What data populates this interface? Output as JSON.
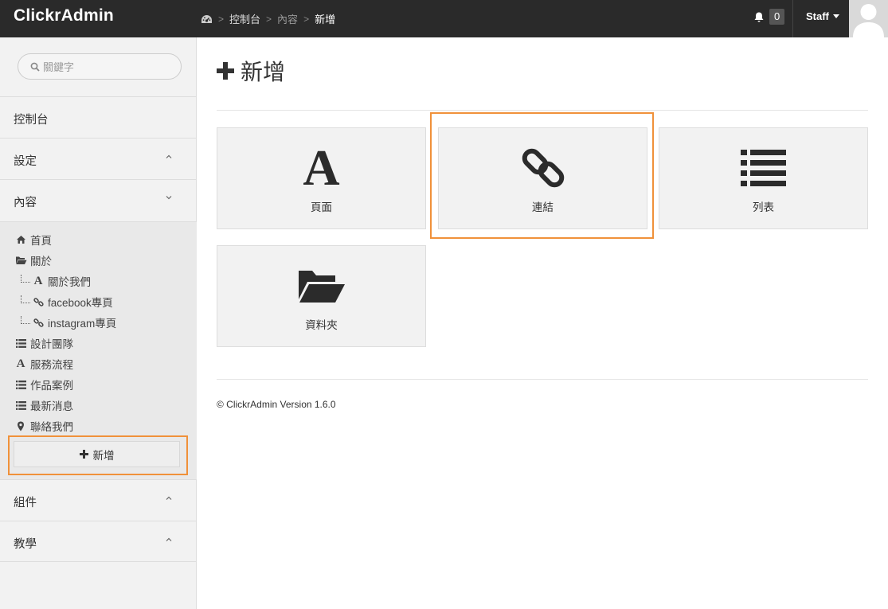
{
  "header": {
    "brand": "ClickrAdmin",
    "breadcrumb": [
      "控制台",
      "內容",
      "新增"
    ],
    "notifications_count": "0",
    "user_label": "Staff"
  },
  "sidebar": {
    "search_placeholder": "關鍵字",
    "sections": {
      "dashboard": "控制台",
      "settings": "設定",
      "content": "內容",
      "components": "組件",
      "tutorials": "教學"
    },
    "tree": [
      {
        "label": "首頁",
        "icon": "home-icon"
      },
      {
        "label": "關於",
        "icon": "folder-open-icon"
      },
      {
        "label": "關於我們",
        "icon": "font-icon"
      },
      {
        "label": "facebook專頁",
        "icon": "link-icon"
      },
      {
        "label": "instagram專頁",
        "icon": "link-icon"
      },
      {
        "label": "設計團隊",
        "icon": "list-icon"
      },
      {
        "label": "服務流程",
        "icon": "font-icon"
      },
      {
        "label": "作品案例",
        "icon": "list-icon"
      },
      {
        "label": "最新消息",
        "icon": "list-icon"
      },
      {
        "label": "聯絡我們",
        "icon": "map-marker-icon"
      }
    ],
    "add_label": "新增"
  },
  "main": {
    "title": "新增",
    "cards": [
      {
        "label": "頁面",
        "icon": "font-icon"
      },
      {
        "label": "連結",
        "icon": "link-icon"
      },
      {
        "label": "列表",
        "icon": "list-icon"
      },
      {
        "label": "資料夾",
        "icon": "folder-open-icon"
      }
    ],
    "footer": "© ClickrAdmin Version 1.6.0"
  },
  "colors": {
    "topbar": "#2a2a2a",
    "highlight": "#f0913a",
    "sidebar_bg": "#f2f2f2",
    "card_bg": "#f2f2f2"
  }
}
